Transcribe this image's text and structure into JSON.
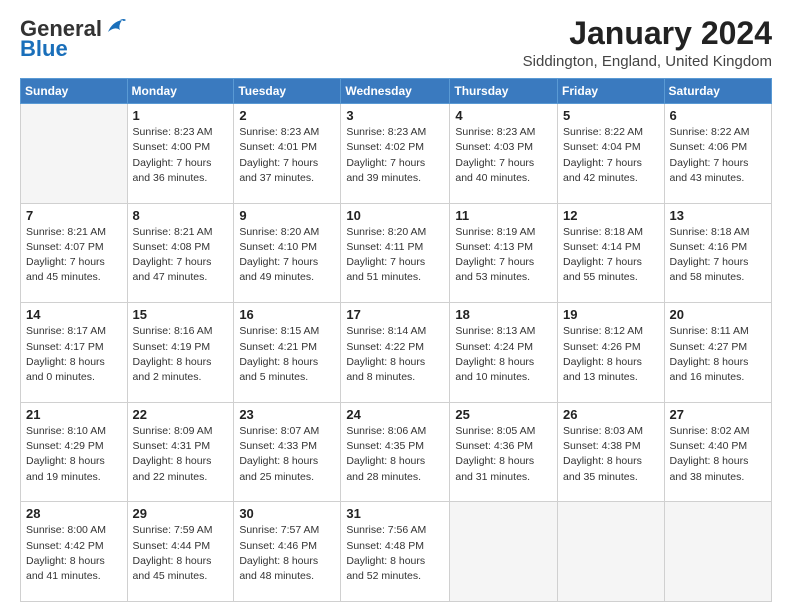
{
  "header": {
    "logo_general": "General",
    "logo_blue": "Blue",
    "month_title": "January 2024",
    "location": "Siddington, England, United Kingdom"
  },
  "days_of_week": [
    "Sunday",
    "Monday",
    "Tuesday",
    "Wednesday",
    "Thursday",
    "Friday",
    "Saturday"
  ],
  "weeks": [
    [
      {
        "day": "",
        "empty": true
      },
      {
        "day": "1",
        "sunrise": "8:23 AM",
        "sunset": "4:00 PM",
        "daylight": "7 hours and 36 minutes."
      },
      {
        "day": "2",
        "sunrise": "8:23 AM",
        "sunset": "4:01 PM",
        "daylight": "7 hours and 37 minutes."
      },
      {
        "day": "3",
        "sunrise": "8:23 AM",
        "sunset": "4:02 PM",
        "daylight": "7 hours and 39 minutes."
      },
      {
        "day": "4",
        "sunrise": "8:23 AM",
        "sunset": "4:03 PM",
        "daylight": "7 hours and 40 minutes."
      },
      {
        "day": "5",
        "sunrise": "8:22 AM",
        "sunset": "4:04 PM",
        "daylight": "7 hours and 42 minutes."
      },
      {
        "day": "6",
        "sunrise": "8:22 AM",
        "sunset": "4:06 PM",
        "daylight": "7 hours and 43 minutes."
      }
    ],
    [
      {
        "day": "7",
        "sunrise": "8:21 AM",
        "sunset": "4:07 PM",
        "daylight": "7 hours and 45 minutes."
      },
      {
        "day": "8",
        "sunrise": "8:21 AM",
        "sunset": "4:08 PM",
        "daylight": "7 hours and 47 minutes."
      },
      {
        "day": "9",
        "sunrise": "8:20 AM",
        "sunset": "4:10 PM",
        "daylight": "7 hours and 49 minutes."
      },
      {
        "day": "10",
        "sunrise": "8:20 AM",
        "sunset": "4:11 PM",
        "daylight": "7 hours and 51 minutes."
      },
      {
        "day": "11",
        "sunrise": "8:19 AM",
        "sunset": "4:13 PM",
        "daylight": "7 hours and 53 minutes."
      },
      {
        "day": "12",
        "sunrise": "8:18 AM",
        "sunset": "4:14 PM",
        "daylight": "7 hours and 55 minutes."
      },
      {
        "day": "13",
        "sunrise": "8:18 AM",
        "sunset": "4:16 PM",
        "daylight": "7 hours and 58 minutes."
      }
    ],
    [
      {
        "day": "14",
        "sunrise": "8:17 AM",
        "sunset": "4:17 PM",
        "daylight": "8 hours and 0 minutes."
      },
      {
        "day": "15",
        "sunrise": "8:16 AM",
        "sunset": "4:19 PM",
        "daylight": "8 hours and 2 minutes."
      },
      {
        "day": "16",
        "sunrise": "8:15 AM",
        "sunset": "4:21 PM",
        "daylight": "8 hours and 5 minutes."
      },
      {
        "day": "17",
        "sunrise": "8:14 AM",
        "sunset": "4:22 PM",
        "daylight": "8 hours and 8 minutes."
      },
      {
        "day": "18",
        "sunrise": "8:13 AM",
        "sunset": "4:24 PM",
        "daylight": "8 hours and 10 minutes."
      },
      {
        "day": "19",
        "sunrise": "8:12 AM",
        "sunset": "4:26 PM",
        "daylight": "8 hours and 13 minutes."
      },
      {
        "day": "20",
        "sunrise": "8:11 AM",
        "sunset": "4:27 PM",
        "daylight": "8 hours and 16 minutes."
      }
    ],
    [
      {
        "day": "21",
        "sunrise": "8:10 AM",
        "sunset": "4:29 PM",
        "daylight": "8 hours and 19 minutes."
      },
      {
        "day": "22",
        "sunrise": "8:09 AM",
        "sunset": "4:31 PM",
        "daylight": "8 hours and 22 minutes."
      },
      {
        "day": "23",
        "sunrise": "8:07 AM",
        "sunset": "4:33 PM",
        "daylight": "8 hours and 25 minutes."
      },
      {
        "day": "24",
        "sunrise": "8:06 AM",
        "sunset": "4:35 PM",
        "daylight": "8 hours and 28 minutes."
      },
      {
        "day": "25",
        "sunrise": "8:05 AM",
        "sunset": "4:36 PM",
        "daylight": "8 hours and 31 minutes."
      },
      {
        "day": "26",
        "sunrise": "8:03 AM",
        "sunset": "4:38 PM",
        "daylight": "8 hours and 35 minutes."
      },
      {
        "day": "27",
        "sunrise": "8:02 AM",
        "sunset": "4:40 PM",
        "daylight": "8 hours and 38 minutes."
      }
    ],
    [
      {
        "day": "28",
        "sunrise": "8:00 AM",
        "sunset": "4:42 PM",
        "daylight": "8 hours and 41 minutes."
      },
      {
        "day": "29",
        "sunrise": "7:59 AM",
        "sunset": "4:44 PM",
        "daylight": "8 hours and 45 minutes."
      },
      {
        "day": "30",
        "sunrise": "7:57 AM",
        "sunset": "4:46 PM",
        "daylight": "8 hours and 48 minutes."
      },
      {
        "day": "31",
        "sunrise": "7:56 AM",
        "sunset": "4:48 PM",
        "daylight": "8 hours and 52 minutes."
      },
      {
        "day": "",
        "empty": true
      },
      {
        "day": "",
        "empty": true
      },
      {
        "day": "",
        "empty": true
      }
    ]
  ],
  "labels": {
    "sunrise": "Sunrise:",
    "sunset": "Sunset:",
    "daylight": "Daylight:"
  }
}
